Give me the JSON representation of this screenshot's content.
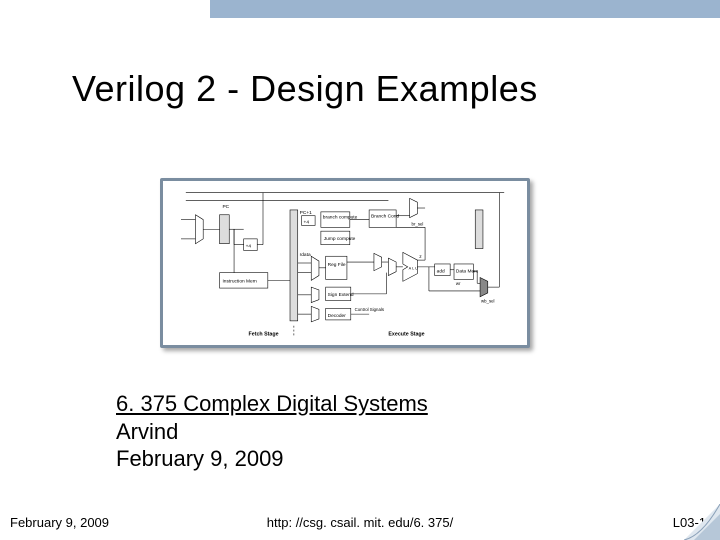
{
  "title": "Verilog 2 - Design Examples",
  "subtitle": {
    "course": "6. 375 Complex Digital Systems",
    "author": "Arvind",
    "date": "February 9, 2009"
  },
  "footer": {
    "left": "February 9, 2009",
    "center": "http: //csg. csail. mit. edu/6. 375/",
    "right": "L03-1"
  },
  "diagram": {
    "labels": {
      "pc": "PC",
      "pc_plus1": "PC+1",
      "plus4": "+4",
      "instr_mem": "Instruction Mem",
      "reg_file": "Reg File",
      "sign_extend": "Sign Extend",
      "branch_compute": "branch compute",
      "jump_compute": "Jump compute",
      "decoder": "Decoder",
      "control_signals": "Control Signals",
      "alu": "A L U",
      "data_mem": "Data Mem",
      "branch_cond": "Branch Cond",
      "z": "z",
      "fetch_stage": "Fetch Stage",
      "execute_stage": "Execute Stage",
      "plus4_2": "+4",
      "add": "add",
      "rdata_sel": "rdata",
      "br_sel": "br_sel",
      "wr": "wr",
      "wb_sel": "wb_sel"
    }
  }
}
